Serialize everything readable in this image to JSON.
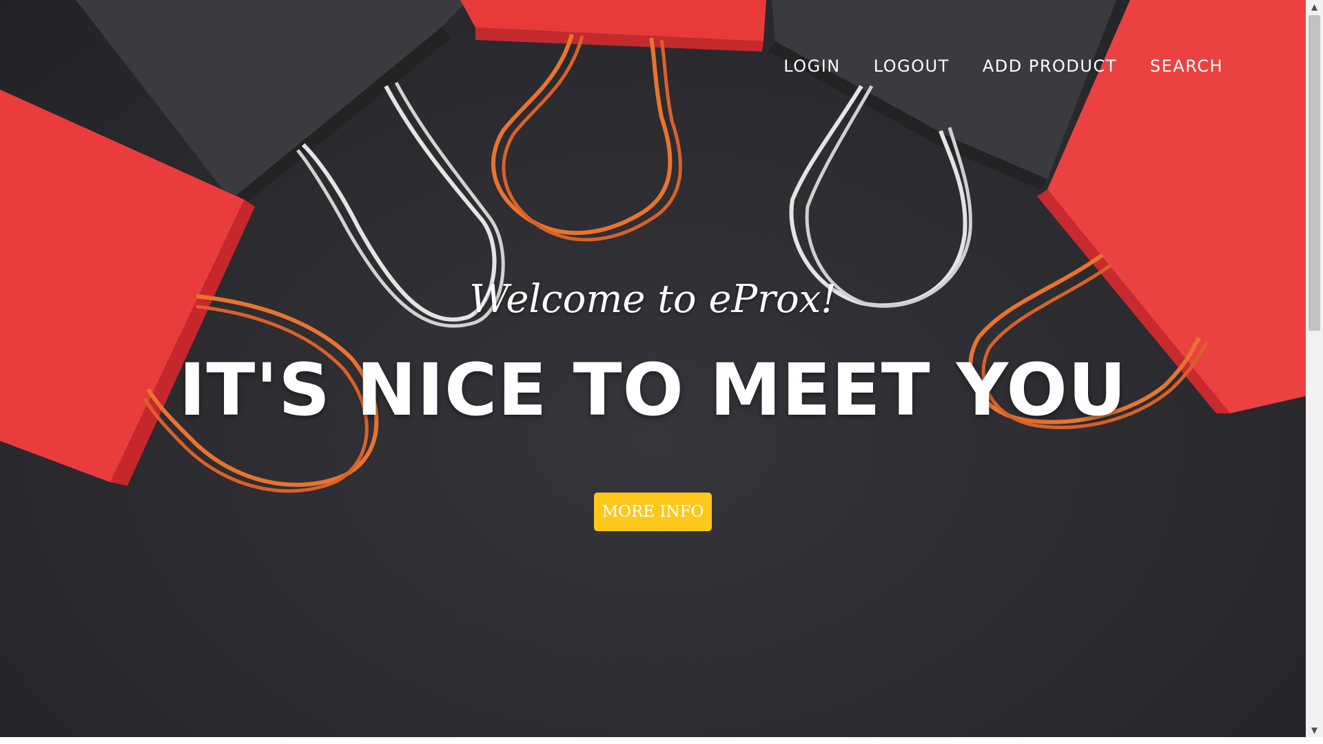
{
  "nav": {
    "items": [
      {
        "label": "LOGIN"
      },
      {
        "label": "LOGOUT"
      },
      {
        "label": "ADD PRODUCT"
      },
      {
        "label": "SEARCH"
      }
    ]
  },
  "hero": {
    "welcome": "Welcome to eProx!",
    "headline": "IT'S NICE TO MEET YOU",
    "cta_label": "MORE INFO"
  },
  "colors": {
    "cta": "#fdc81a",
    "background": "#2b2b30",
    "bag_red": "#ea3b3b",
    "bag_dark": "#3c3c40",
    "string_orange": "#e8742f",
    "string_white": "#e6e6e6"
  },
  "icons": {
    "scroll_up": "▲",
    "scroll_down": "▼"
  }
}
